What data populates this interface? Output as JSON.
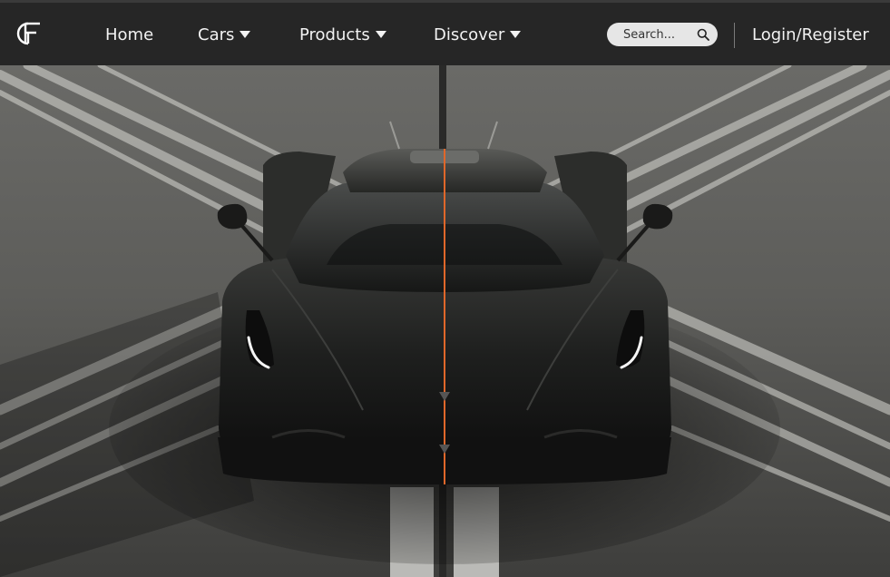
{
  "brand": {
    "logo_text": "GF",
    "logo_icon": "gf-monogram-logo"
  },
  "nav": {
    "items": [
      {
        "label": "Home",
        "has_dropdown": false
      },
      {
        "label": "Cars",
        "has_dropdown": true
      },
      {
        "label": "Products",
        "has_dropdown": true
      },
      {
        "label": "Discover",
        "has_dropdown": true
      }
    ]
  },
  "search": {
    "placeholder": "Search...",
    "value": "",
    "icon": "search-icon"
  },
  "auth": {
    "label": "Login/Register"
  },
  "hero": {
    "image": "black-supercar-front-view-on-runway",
    "colors": {
      "nav_bg": "#262626",
      "accent_stripe": "#e0672a",
      "asphalt": "#5a5a58",
      "car_body": "#1b1c1b"
    }
  }
}
